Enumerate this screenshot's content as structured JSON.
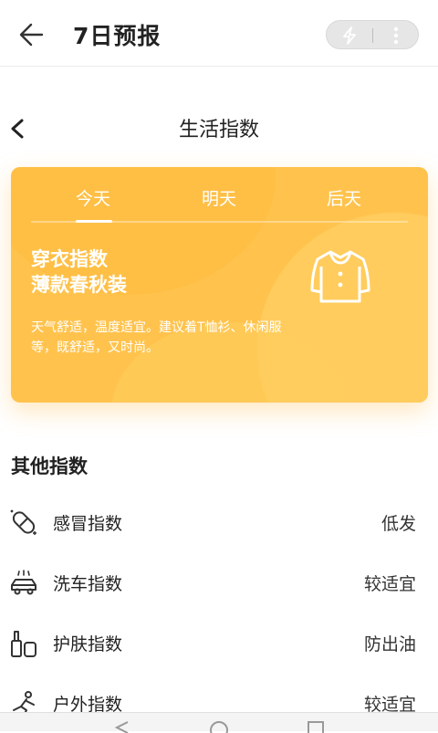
{
  "header": {
    "title": "7日预报"
  },
  "sub_header": {
    "title": "生活指数"
  },
  "card": {
    "tabs": [
      "今天",
      "明天",
      "后天"
    ],
    "selected_tab": "今天",
    "index_name": "穿衣指数",
    "index_value": "薄款春秋装",
    "description": "天气舒适，温度适宜。建议着T恤衫、休闲服等，既舒适，又时尚。"
  },
  "others": {
    "title": "其他指数",
    "items": [
      {
        "label": "感冒指数",
        "value": "低发",
        "icon": "pill-icon"
      },
      {
        "label": "洗车指数",
        "value": "较适宜",
        "icon": "car-wash-icon"
      },
      {
        "label": "护肤指数",
        "value": "防出油",
        "icon": "cosmetics-icon"
      },
      {
        "label": "户外指数",
        "value": "较适宜",
        "icon": "outdoor-icon"
      }
    ]
  },
  "colors": {
    "card_bg": "#ffc34d",
    "accent": "#ffb83a"
  }
}
